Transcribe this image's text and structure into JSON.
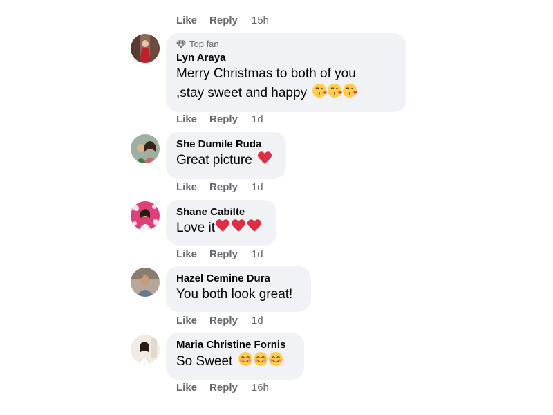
{
  "actions": {
    "like": "Like",
    "reply": "Reply"
  },
  "top_item": {
    "time": "15h"
  },
  "comments": [
    {
      "badge": "Top fan",
      "author": "Lyn Araya",
      "text_line1": "Merry Christmas to both of you",
      "text_line2": ",stay sweet and happy",
      "emoji": "kissing-face-emoji",
      "time": "1d"
    },
    {
      "author": "She Dumile Ruda",
      "text": "Great picture",
      "emoji": "red-heart-emoji",
      "time": "1d"
    },
    {
      "author": "Shane Cabilte",
      "text": "Love it",
      "emoji": "red-heart-emoji",
      "time": "1d"
    },
    {
      "author": "Hazel Cemine Dura",
      "text": "You both look great!",
      "time": "1d"
    },
    {
      "author": "Maria Christine Fornis",
      "text": "So Sweet",
      "emoji": "smiling-blush-emoji",
      "time": "16h"
    }
  ],
  "colors": {
    "bubble": "#f0f2f5",
    "meta_text": "#65676b",
    "body_text": "#050505",
    "heart": "#e0245e",
    "emoji_face": "#ffcc4d"
  }
}
